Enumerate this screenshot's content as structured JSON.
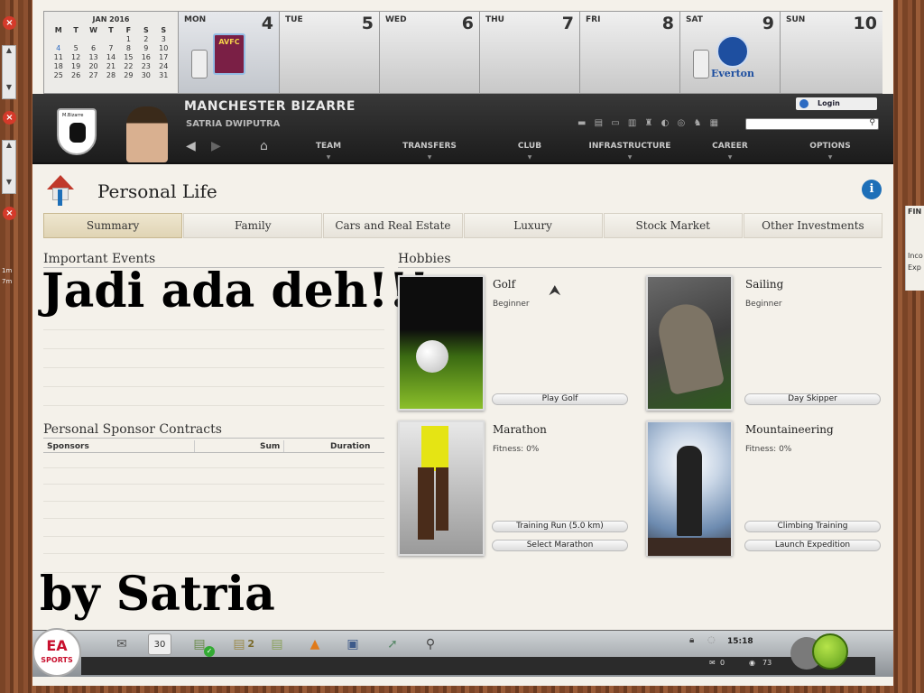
{
  "calendar": {
    "month": "JAN 2016",
    "weekday_headers": [
      "M",
      "T",
      "W",
      "T",
      "F",
      "S",
      "S"
    ],
    "weeks": [
      [
        "",
        "",
        "",
        "",
        "1",
        "2",
        "3"
      ],
      [
        "4",
        "5",
        "6",
        "7",
        "8",
        "9",
        "10"
      ],
      [
        "11",
        "12",
        "13",
        "14",
        "15",
        "16",
        "17"
      ],
      [
        "18",
        "19",
        "20",
        "21",
        "22",
        "23",
        "24"
      ],
      [
        "25",
        "26",
        "27",
        "28",
        "29",
        "30",
        "31"
      ]
    ],
    "days": [
      {
        "name": "MON",
        "date": "4"
      },
      {
        "name": "TUE",
        "date": "5"
      },
      {
        "name": "WED",
        "date": "6"
      },
      {
        "name": "THU",
        "date": "7"
      },
      {
        "name": "FRI",
        "date": "8"
      },
      {
        "name": "SAT",
        "date": "9"
      },
      {
        "name": "SUN",
        "date": "10"
      }
    ],
    "mon_badge": "AVFC",
    "sat_badge": "Everton"
  },
  "header": {
    "club": "MANCHESTER BIZARRE",
    "manager": "SATRIA DWIPUTRA",
    "shield_text": "M.Bizarre",
    "login": "Login",
    "nav": [
      "TEAM",
      "TRANSFERS",
      "CLUB",
      "INFRASTRUCTURE",
      "CAREER",
      "OPTIONS"
    ]
  },
  "page": {
    "title": "Personal Life",
    "tabs": [
      "Summary",
      "Family",
      "Cars and Real Estate",
      "Luxury",
      "Stock Market",
      "Other Investments"
    ],
    "important_events": "Important Events",
    "overlay_1": "Jadi ada deh!!!",
    "sponsor_section": "Personal Sponsor Contracts",
    "sponsor_cols": [
      "Sponsors",
      "Sum",
      "Duration"
    ],
    "overlay_2": "by Satria",
    "hobbies_title": "Hobbies",
    "hobbies": [
      {
        "name": "Golf",
        "sub": "Beginner",
        "buttons": [
          "Play Golf"
        ]
      },
      {
        "name": "Sailing",
        "sub": "Beginner",
        "buttons": [
          "Day Skipper"
        ]
      },
      {
        "name": "Marathon",
        "sub": "Fitness: 0%",
        "buttons": [
          "Training Run (5.0 km)",
          "Select Marathon"
        ]
      },
      {
        "name": "Mountaineering",
        "sub": "Fitness: 0%",
        "buttons": [
          "Climbing Training",
          "Launch Expedition"
        ]
      }
    ]
  },
  "rightwin": {
    "title": "FIN",
    "lines": [
      "Inco",
      "Exp"
    ]
  },
  "leftwin": {
    "lines": [
      "1m",
      "7m"
    ]
  },
  "bottom": {
    "ea": "EA",
    "sports": "SPORTS",
    "calendar_day": "30",
    "badge_count": "2",
    "time": "15:18",
    "mail_count": "0",
    "support_count": "73"
  }
}
